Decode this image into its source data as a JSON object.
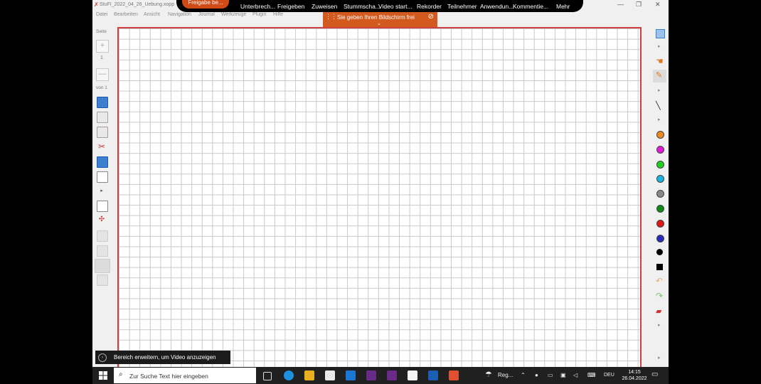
{
  "window": {
    "title": "StuFI_2022_04_26_Uebung.xopp",
    "controls": [
      "—",
      "❐",
      "✕"
    ]
  },
  "menu": [
    "Datei",
    "Bearbeiten",
    "Ansicht",
    "Navigation",
    "Journal",
    "Werkzeuge",
    "Plugin",
    "Hilfe"
  ],
  "meeting_bar": {
    "freigabe_label": "Freigabe be...",
    "items": [
      "Unterbrech...",
      "Freigeben",
      "Zuweisen",
      "Stummscha...",
      "Video start...",
      "Rekorder",
      "Teilnehmer",
      "Anwendun...",
      "Kommentie...",
      "Mehr"
    ]
  },
  "share_banner": {
    "text": "Sie geben Ihren Bildschirm frei"
  },
  "page_panel": {
    "label": "Seite",
    "plus": "+",
    "page_number": "1",
    "minus": "—",
    "total": "von 1"
  },
  "colors": {
    "accent": "#d35a1f",
    "page_border": "#d04040",
    "palette": [
      "#f08a1e",
      "#e01ad8",
      "#1fd01f",
      "#18b4e6",
      "#888888",
      "#0d8a1a",
      "#e01818",
      "#2a2abf",
      "#000000"
    ]
  },
  "notification": {
    "text": "Bereich erweitern, um Video anzuzeigen"
  },
  "taskbar": {
    "search_placeholder": "Zur Suche Text hier eingeben",
    "weather": "Reg...",
    "lang": "DEU",
    "time": "14:15",
    "date": "26.04.2022"
  }
}
